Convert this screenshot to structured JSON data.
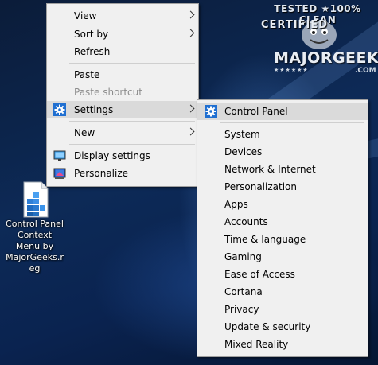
{
  "context_menu": {
    "items": [
      {
        "label": "View",
        "has_submenu": true,
        "enabled": true
      },
      {
        "label": "Sort by",
        "has_submenu": true,
        "enabled": true
      },
      {
        "label": "Refresh",
        "has_submenu": false,
        "enabled": true
      },
      {
        "label": "Paste",
        "has_submenu": false,
        "enabled": true
      },
      {
        "label": "Paste shortcut",
        "has_submenu": false,
        "enabled": false
      },
      {
        "label": "Settings",
        "has_submenu": true,
        "enabled": true,
        "icon": "gear-icon",
        "highlighted": true
      },
      {
        "label": "New",
        "has_submenu": true,
        "enabled": true
      },
      {
        "label": "Display settings",
        "has_submenu": false,
        "enabled": true,
        "icon": "display-settings-icon"
      },
      {
        "label": "Personalize",
        "has_submenu": false,
        "enabled": true,
        "icon": "personalize-icon"
      }
    ]
  },
  "settings_submenu": {
    "items": [
      {
        "label": "Control Panel",
        "icon": "gear-icon",
        "highlighted": true
      },
      {
        "label": "System"
      },
      {
        "label": "Devices"
      },
      {
        "label": "Network & Internet"
      },
      {
        "label": "Personalization"
      },
      {
        "label": "Apps"
      },
      {
        "label": "Accounts"
      },
      {
        "label": "Time & language"
      },
      {
        "label": "Gaming"
      },
      {
        "label": "Ease of Access"
      },
      {
        "label": "Cortana"
      },
      {
        "label": "Privacy"
      },
      {
        "label": "Update & security"
      },
      {
        "label": "Mixed Reality"
      }
    ]
  },
  "desktop_icon": {
    "icon": "registry-file-icon",
    "caption_lines": [
      "Control Panel",
      "Context",
      "Menu by",
      "MajorGeeks.r",
      "eg"
    ]
  },
  "watermark": {
    "top_line": "TESTED ★100% CLEAN",
    "certified": "CERTIFIED",
    "brand": "MAJORGEEKS",
    "domain": ".COM",
    "stars": "★★★★★★"
  },
  "colors": {
    "menu_background": "#f0f0f0",
    "menu_highlight": "#dadada",
    "disabled_text": "#8c8c8c",
    "gear_blue": "#1f6fd1"
  }
}
